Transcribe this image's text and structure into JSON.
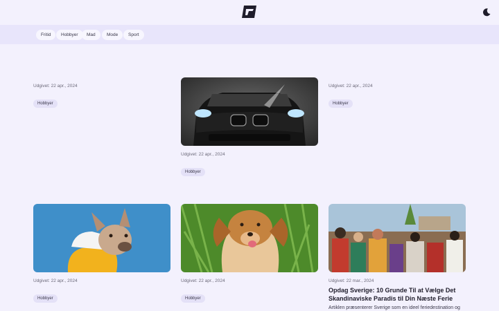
{
  "header": {
    "logo_icon": "brand-logo-icon",
    "theme_toggle_icon": "moon-icon"
  },
  "categories": [
    {
      "label": "Fritid"
    },
    {
      "label": "Hobbyer"
    },
    {
      "label": "Mad"
    },
    {
      "label": "Mode"
    },
    {
      "label": "Sport"
    }
  ],
  "articles": [
    {
      "date": "Udgivet: 22 apr., 2024",
      "tag": "Hobbyer"
    },
    {
      "date": "Udgivet: 22 apr., 2024",
      "tag": "Hobbyer"
    },
    {
      "date": "Udgivet: 22 apr., 2024",
      "tag": "Hobbyer"
    },
    {
      "date": "Udgivet: 22 apr., 2024",
      "tag": "Hobbyer"
    },
    {
      "date": "Udgivet: 22 apr., 2024",
      "tag": "Hobbyer"
    },
    {
      "date": "Udgivet: 22 mar., 2024",
      "title": "Opdag Sverige: 10 Grunde Til at Vælge Det Skandinaviske Paradis til Din Næste Ferie",
      "excerpt": "Artiklen præsenterer Sverige som en ideel feriedestination og"
    }
  ]
}
